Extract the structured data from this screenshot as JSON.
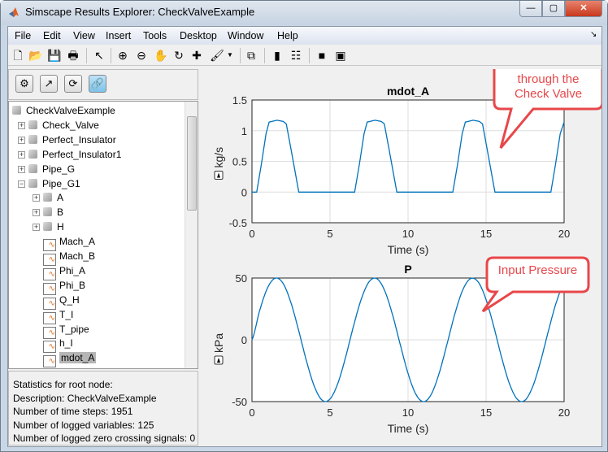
{
  "window": {
    "title": "Simscape Results Explorer: CheckValveExample",
    "minimize": "—",
    "maximize": "▢",
    "close": "✕"
  },
  "menu": [
    "File",
    "Edit",
    "View",
    "Insert",
    "Tools",
    "Desktop",
    "Window",
    "Help"
  ],
  "toolbar": [
    {
      "icon": "new-figure-icon",
      "glyph": "🗋"
    },
    {
      "icon": "open-icon",
      "glyph": "📂"
    },
    {
      "icon": "save-icon",
      "glyph": "💾"
    },
    {
      "icon": "print-icon",
      "glyph": "🖶"
    },
    {
      "icon": "pointer-icon",
      "glyph": "↖"
    },
    {
      "icon": "zoom-in-icon",
      "glyph": "⊕"
    },
    {
      "icon": "zoom-out-icon",
      "glyph": "⊖"
    },
    {
      "icon": "pan-icon",
      "glyph": "✋"
    },
    {
      "icon": "rotate-icon",
      "glyph": "↻"
    },
    {
      "icon": "data-cursor-icon",
      "glyph": "✚"
    },
    {
      "icon": "brush-icon",
      "glyph": "🖌"
    },
    {
      "icon": "link-plot-icon",
      "glyph": "⧉"
    },
    {
      "icon": "colorbar-icon",
      "glyph": "▮"
    },
    {
      "icon": "legend-icon",
      "glyph": "☷"
    },
    {
      "icon": "hide-plot-tools-icon",
      "glyph": "■"
    },
    {
      "icon": "show-plot-tools-icon",
      "glyph": "▣"
    }
  ],
  "left_tools": [
    {
      "icon": "options-icon",
      "glyph": "⚙"
    },
    {
      "icon": "plot-signal-icon",
      "glyph": "↗"
    },
    {
      "icon": "reload-icon",
      "glyph": "⟳"
    },
    {
      "icon": "link-icon",
      "glyph": "🔗"
    }
  ],
  "tree": [
    {
      "label": "CheckValveExample",
      "level": 0,
      "type": "node",
      "expander": ""
    },
    {
      "label": "Check_Valve",
      "level": 1,
      "type": "node",
      "expander": "+"
    },
    {
      "label": "Perfect_Insulator",
      "level": 1,
      "type": "node",
      "expander": "+"
    },
    {
      "label": "Perfect_Insulator1",
      "level": 1,
      "type": "node",
      "expander": "+"
    },
    {
      "label": "Pipe_G",
      "level": 1,
      "type": "node",
      "expander": "+"
    },
    {
      "label": "Pipe_G1",
      "level": 1,
      "type": "node",
      "expander": "-"
    },
    {
      "label": "A",
      "level": 2,
      "type": "node",
      "expander": "+"
    },
    {
      "label": "B",
      "level": 2,
      "type": "node",
      "expander": "+"
    },
    {
      "label": "H",
      "level": 2,
      "type": "node",
      "expander": "+"
    },
    {
      "label": "Mach_A",
      "level": 2,
      "type": "signal",
      "expander": ""
    },
    {
      "label": "Mach_B",
      "level": 2,
      "type": "signal",
      "expander": ""
    },
    {
      "label": "Phi_A",
      "level": 2,
      "type": "signal",
      "expander": ""
    },
    {
      "label": "Phi_B",
      "level": 2,
      "type": "signal",
      "expander": ""
    },
    {
      "label": "Q_H",
      "level": 2,
      "type": "signal",
      "expander": ""
    },
    {
      "label": "T_I",
      "level": 2,
      "type": "signal",
      "expander": ""
    },
    {
      "label": "T_pipe",
      "level": 2,
      "type": "signal",
      "expander": ""
    },
    {
      "label": "h_I",
      "level": 2,
      "type": "signal",
      "expander": ""
    },
    {
      "label": "mdot_A",
      "level": 2,
      "type": "signal",
      "expander": "",
      "selected": true
    }
  ],
  "stats": [
    "Statistics for root node:",
    "Description: CheckValveExample",
    "Number of time steps: 1951",
    "Number of logged variables: 125",
    "Number of logged zero crossing signals: 0"
  ],
  "callouts": {
    "top": "Mass flow through the Check Valve",
    "bottom": "Input Pressure",
    "color": "#e8474a"
  },
  "chart_data": [
    {
      "type": "line",
      "title": "mdot_A",
      "xlabel": "Time (s)",
      "ylabel": "kg/s",
      "xlim": [
        0,
        20
      ],
      "ylim": [
        -0.5,
        1.5
      ],
      "xticks": [
        0,
        5,
        10,
        15,
        20
      ],
      "yticks": [
        -0.5,
        0,
        0.5,
        1,
        1.5
      ],
      "grid": true,
      "color": "#0072bd",
      "x": [
        0,
        0.3,
        0.6,
        0.9,
        1.1,
        1.6,
        2.0,
        2.2,
        2.5,
        3.0,
        6.58,
        6.88,
        7.18,
        7.38,
        7.88,
        8.28,
        8.48,
        8.78,
        9.28,
        12.87,
        13.17,
        13.47,
        13.67,
        14.17,
        14.57,
        14.77,
        15.07,
        15.57,
        19.15,
        19.45,
        19.75,
        20
      ],
      "y": [
        0,
        0,
        0.45,
        0.95,
        1.14,
        1.17,
        1.15,
        1.11,
        0.7,
        0,
        0,
        0.45,
        0.95,
        1.14,
        1.17,
        1.15,
        1.11,
        0.7,
        0,
        0,
        0.45,
        0.95,
        1.14,
        1.17,
        1.15,
        1.11,
        0.7,
        0,
        0,
        0.45,
        0.95,
        1.14
      ]
    },
    {
      "type": "line",
      "title": "P",
      "xlabel": "Time (s)",
      "ylabel": "kPa",
      "xlim": [
        0,
        20
      ],
      "ylim": [
        -50,
        50
      ],
      "xticks": [
        0,
        5,
        10,
        15,
        20
      ],
      "yticks": [
        -50,
        0,
        50
      ],
      "grid": true,
      "color": "#0072bd",
      "x": [
        0,
        0.5,
        1,
        1.5,
        2,
        2.5,
        3,
        3.5,
        4,
        4.5,
        5,
        5.5,
        6,
        6.5,
        7,
        7.5,
        8,
        8.5,
        9,
        9.5,
        10,
        10.5,
        11,
        11.5,
        12,
        12.5,
        13,
        13.5,
        14,
        14.5,
        15,
        15.5,
        16,
        16.5,
        17,
        17.5,
        18,
        18.5,
        19,
        19.5,
        20
      ],
      "y": [
        0,
        24.0,
        42.1,
        49.9,
        45.5,
        29.9,
        7.1,
        -17.5,
        -37.8,
        -48.9,
        -47.9,
        -35.3,
        -14.0,
        10.8,
        32.8,
        46.9,
        49.5,
        39.9,
        20.6,
        -3.8,
        -27.2,
        -44.0,
        -50.0,
        -43.8,
        -26.8,
        -3.3,
        21.0,
        40.2,
        49.5,
        46.7,
        32.5,
        10.4,
        -14.4,
        -35.6,
        -48.1,
        -48.8,
        -37.5,
        -17.1,
        7.5,
        30.3,
        45.6
      ]
    }
  ]
}
